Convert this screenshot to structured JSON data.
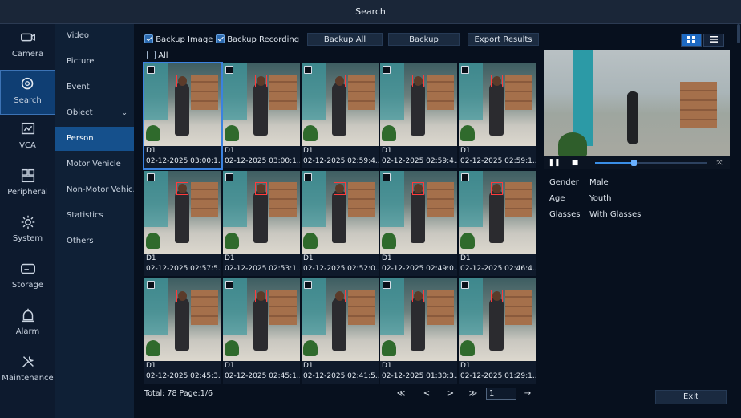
{
  "window": {
    "title": "Search"
  },
  "nav": [
    {
      "label": "Camera",
      "icon": "camera-icon",
      "active": false
    },
    {
      "label": "Search",
      "icon": "search-icon",
      "active": true
    },
    {
      "label": "VCA",
      "icon": "vca-icon",
      "active": false
    },
    {
      "label": "Peripheral",
      "icon": "peripheral-icon",
      "active": false
    },
    {
      "label": "System",
      "icon": "gear-icon",
      "active": false
    },
    {
      "label": "Storage",
      "icon": "storage-icon",
      "active": false
    },
    {
      "label": "Alarm",
      "icon": "alarm-icon",
      "active": false
    },
    {
      "label": "Maintenance",
      "icon": "wrench-icon",
      "active": false
    }
  ],
  "subnav": [
    {
      "label": "Video",
      "active": false
    },
    {
      "label": "Picture",
      "active": false
    },
    {
      "label": "Event",
      "active": false
    },
    {
      "label": "Object",
      "active": false,
      "chevron": "⌄"
    },
    {
      "label": "Person",
      "active": true
    },
    {
      "label": "Motor Vehicle",
      "active": false
    },
    {
      "label": "Non-Motor Vehic..",
      "active": false
    },
    {
      "label": "Statistics",
      "active": false
    },
    {
      "label": "Others",
      "active": false
    }
  ],
  "toolbar": {
    "backup_image": {
      "label": "Backup Image",
      "checked": true
    },
    "backup_recording": {
      "label": "Backup Recording",
      "checked": true
    },
    "backup_all": "Backup All",
    "backup": "Backup",
    "export_results": "Export Results",
    "all_label": "All"
  },
  "view": {
    "grid_icon": "grid-view-icon",
    "list_icon": "list-view-icon"
  },
  "thumbnails": [
    {
      "cam": "D1",
      "ts": "02-12-2025 03:00:1...",
      "selected": true
    },
    {
      "cam": "D1",
      "ts": "02-12-2025 03:00:1..."
    },
    {
      "cam": "D1",
      "ts": "02-12-2025 02:59:4..."
    },
    {
      "cam": "D1",
      "ts": "02-12-2025 02:59:4..."
    },
    {
      "cam": "D1",
      "ts": "02-12-2025 02:59:1..."
    },
    {
      "cam": "D1",
      "ts": "02-12-2025 02:57:5..."
    },
    {
      "cam": "D1",
      "ts": "02-12-2025 02:53:1..."
    },
    {
      "cam": "D1",
      "ts": "02-12-2025 02:52:0..."
    },
    {
      "cam": "D1",
      "ts": "02-12-2025 02:49:0..."
    },
    {
      "cam": "D1",
      "ts": "02-12-2025 02:46:4..."
    },
    {
      "cam": "D1",
      "ts": "02-12-2025 02:45:3..."
    },
    {
      "cam": "D1",
      "ts": "02-12-2025 02:45:1..."
    },
    {
      "cam": "D1",
      "ts": "02-12-2025 02:41:5..."
    },
    {
      "cam": "D1",
      "ts": "02-12-2025 01:30:3..."
    },
    {
      "cam": "D1",
      "ts": "02-12-2025 01:29:1..."
    }
  ],
  "footer": {
    "summary": "Total: 78  Page:1/6",
    "first": "≪",
    "prev": "<",
    "next": ">",
    "last": "≫",
    "page_value": "1",
    "go": "→"
  },
  "player": {
    "pause": "❚❚",
    "stop": "■",
    "progress": 0.34,
    "fullscreen": "⤧"
  },
  "attributes": [
    {
      "key": "Gender",
      "value": "Male"
    },
    {
      "key": "Age",
      "value": "Youth"
    },
    {
      "key": "Glasses",
      "value": "With Glasses"
    }
  ],
  "exit": "Exit"
}
